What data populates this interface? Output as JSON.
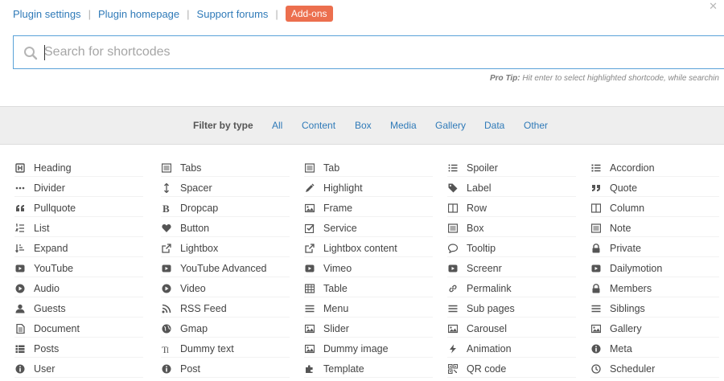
{
  "toplinks": {
    "plugin_settings": "Plugin settings",
    "plugin_homepage": "Plugin homepage",
    "support_forums": "Support forums",
    "addons": "Add-ons",
    "separator": "|"
  },
  "search": {
    "placeholder": "Search for shortcodes",
    "pro_tip_label": "Pro Tip:",
    "pro_tip_text": " Hit enter to select highlighted shortcode, while searchin"
  },
  "filter": {
    "label": "Filter by type",
    "types": [
      "All",
      "Content",
      "Box",
      "Media",
      "Gallery",
      "Data",
      "Other"
    ]
  },
  "colors": {
    "link": "#2f7ab8",
    "addons_bg": "#ec6f4e",
    "search_border": "#5aa2d8",
    "filter_bg": "#eeeeee"
  },
  "shortcodes": [
    [
      {
        "label": "Heading",
        "icon": "heading-icon"
      },
      {
        "label": "Divider",
        "icon": "ellipsis-icon"
      },
      {
        "label": "Pullquote",
        "icon": "quote-left-icon"
      },
      {
        "label": "List",
        "icon": "list-ol-icon"
      },
      {
        "label": "Expand",
        "icon": "sort-amount-icon"
      },
      {
        "label": "YouTube",
        "icon": "youtube-play-icon"
      },
      {
        "label": "Audio",
        "icon": "play-circle-icon"
      },
      {
        "label": "Guests",
        "icon": "user-icon"
      },
      {
        "label": "Document",
        "icon": "file-text-icon"
      },
      {
        "label": "Posts",
        "icon": "th-list-icon"
      },
      {
        "label": "User",
        "icon": "info-circle-icon"
      }
    ],
    [
      {
        "label": "Tabs",
        "icon": "list-alt-icon"
      },
      {
        "label": "Spacer",
        "icon": "arrows-v-icon"
      },
      {
        "label": "Dropcap",
        "icon": "bold-icon"
      },
      {
        "label": "Button",
        "icon": "heart-icon"
      },
      {
        "label": "Lightbox",
        "icon": "external-link-icon"
      },
      {
        "label": "YouTube Advanced",
        "icon": "youtube-play-icon"
      },
      {
        "label": "Video",
        "icon": "play-circle-icon"
      },
      {
        "label": "RSS Feed",
        "icon": "rss-icon"
      },
      {
        "label": "Gmap",
        "icon": "globe-icon"
      },
      {
        "label": "Dummy text",
        "icon": "text-height-icon"
      },
      {
        "label": "Post",
        "icon": "info-circle-icon"
      }
    ],
    [
      {
        "label": "Tab",
        "icon": "list-alt-icon"
      },
      {
        "label": "Highlight",
        "icon": "pencil-icon"
      },
      {
        "label": "Frame",
        "icon": "picture-icon"
      },
      {
        "label": "Service",
        "icon": "check-square-icon"
      },
      {
        "label": "Lightbox content",
        "icon": "external-link-icon"
      },
      {
        "label": "Vimeo",
        "icon": "youtube-play-icon"
      },
      {
        "label": "Table",
        "icon": "table-icon"
      },
      {
        "label": "Menu",
        "icon": "bars-icon"
      },
      {
        "label": "Slider",
        "icon": "picture-icon"
      },
      {
        "label": "Dummy image",
        "icon": "picture-icon"
      },
      {
        "label": "Template",
        "icon": "puzzle-piece-icon"
      }
    ],
    [
      {
        "label": "Spoiler",
        "icon": "list-ul-icon"
      },
      {
        "label": "Label",
        "icon": "tag-icon"
      },
      {
        "label": "Row",
        "icon": "columns-icon"
      },
      {
        "label": "Box",
        "icon": "list-alt-icon"
      },
      {
        "label": "Tooltip",
        "icon": "comment-icon"
      },
      {
        "label": "Screenr",
        "icon": "youtube-play-icon"
      },
      {
        "label": "Permalink",
        "icon": "link-icon"
      },
      {
        "label": "Sub pages",
        "icon": "bars-icon"
      },
      {
        "label": "Carousel",
        "icon": "picture-icon"
      },
      {
        "label": "Animation",
        "icon": "bolt-icon"
      },
      {
        "label": "QR code",
        "icon": "qrcode-icon"
      }
    ],
    [
      {
        "label": "Accordion",
        "icon": "list-icon"
      },
      {
        "label": "Quote",
        "icon": "quote-right-icon"
      },
      {
        "label": "Column",
        "icon": "columns-icon"
      },
      {
        "label": "Note",
        "icon": "list-alt-icon"
      },
      {
        "label": "Private",
        "icon": "lock-icon"
      },
      {
        "label": "Dailymotion",
        "icon": "youtube-play-icon"
      },
      {
        "label": "Members",
        "icon": "lock-icon"
      },
      {
        "label": "Siblings",
        "icon": "bars-icon"
      },
      {
        "label": "Gallery",
        "icon": "picture-icon"
      },
      {
        "label": "Meta",
        "icon": "info-circle-icon"
      },
      {
        "label": "Scheduler",
        "icon": "clock-icon"
      }
    ]
  ]
}
